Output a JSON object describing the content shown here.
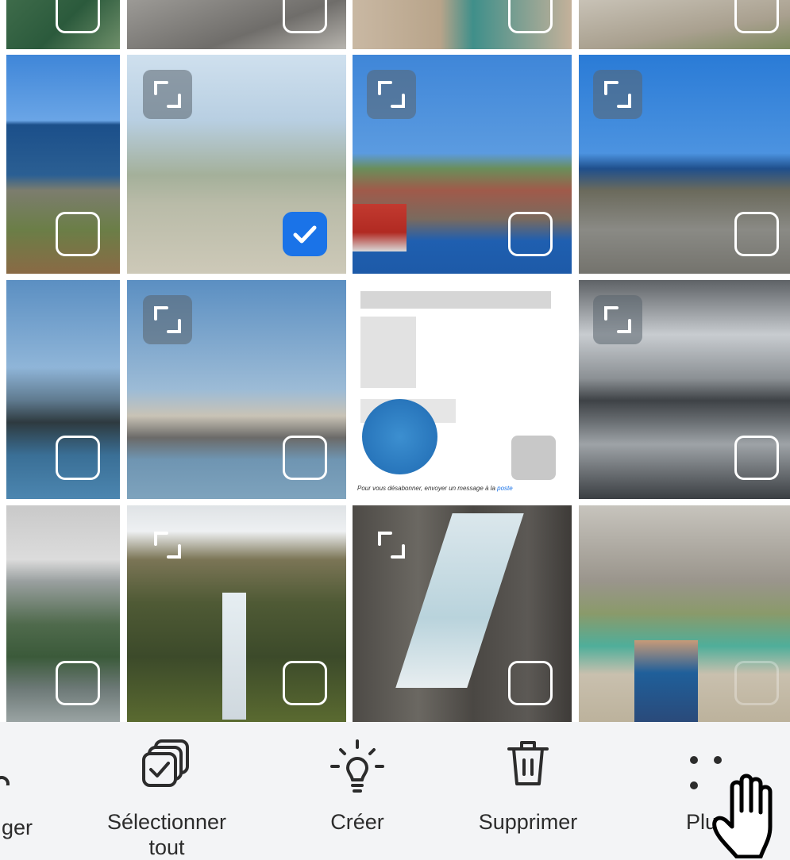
{
  "photo_grid": {
    "tiles": [
      {
        "name": "photo-r0c0",
        "selected": false
      },
      {
        "name": "photo-r0c1",
        "selected": false
      },
      {
        "name": "photo-r0c2",
        "selected": false
      },
      {
        "name": "photo-r0c3",
        "selected": false
      },
      {
        "name": "photo-coast-rocks",
        "selected": false
      },
      {
        "name": "photo-viewpoint-road",
        "selected": true
      },
      {
        "name": "photo-harbour-town",
        "selected": false
      },
      {
        "name": "photo-rocky-shore",
        "selected": false
      },
      {
        "name": "photo-bridge-fjord",
        "selected": false
      },
      {
        "name": "photo-mountains-lake",
        "selected": false
      },
      {
        "name": "photo-screenshot-message",
        "selected": false
      },
      {
        "name": "photo-cloudy-sea",
        "selected": false
      },
      {
        "name": "photo-valley-lake",
        "selected": false
      },
      {
        "name": "photo-waterfall",
        "selected": false
      },
      {
        "name": "photo-glacier",
        "selected": false
      },
      {
        "name": "photo-people-pixelated",
        "selected": false
      }
    ],
    "screenshot_caption": "Pour vous désabonner, envoyer un message à la",
    "screenshot_caption_link": "poste"
  },
  "toolbar": {
    "partial_label": "ger",
    "select_all_label_line1": "Sélectionner",
    "select_all_label_line2": "tout",
    "create_label": "Créer",
    "delete_label": "Supprimer",
    "more_label": "Plus"
  },
  "colors": {
    "accent": "#1a73e8",
    "toolbar_bg": "#f3f4f6",
    "text": "#2c2c2c"
  }
}
